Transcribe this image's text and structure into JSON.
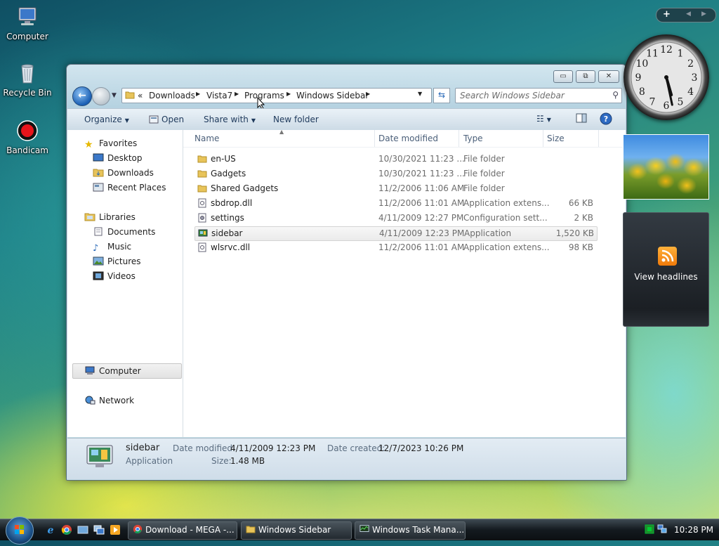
{
  "desktop": {
    "icons": [
      {
        "label": "Computer",
        "icon": "computer-icon"
      },
      {
        "label": "Recycle Bin",
        "icon": "recycle-bin-icon"
      },
      {
        "label": "Bandicam",
        "icon": "bandicam-icon"
      }
    ]
  },
  "window": {
    "buttons": {
      "minimize": "▭",
      "maximize": "⧉",
      "close": "✕"
    },
    "breadcrumb": [
      "«",
      "Downloads",
      "Vista7",
      "Programs",
      "Windows Sidebar"
    ],
    "search_placeholder": "Search Windows Sidebar",
    "toolbar": {
      "organize": "Organize",
      "open": "Open",
      "share_with": "Share with",
      "new_folder": "New folder"
    },
    "nav": {
      "favorites": "Favorites",
      "desktop": "Desktop",
      "downloads": "Downloads",
      "recent_places": "Recent Places",
      "libraries": "Libraries",
      "documents": "Documents",
      "music": "Music",
      "pictures": "Pictures",
      "videos": "Videos",
      "computer": "Computer",
      "network": "Network"
    },
    "columns": {
      "name": "Name",
      "date_modified": "Date modified",
      "type": "Type",
      "size": "Size"
    },
    "files": [
      {
        "name": "en-US",
        "date": "10/30/2021 11:23 ...",
        "type": "File folder",
        "size": "",
        "icon": "folder-icon"
      },
      {
        "name": "Gadgets",
        "date": "10/30/2021 11:23 ...",
        "type": "File folder",
        "size": "",
        "icon": "folder-icon"
      },
      {
        "name": "Shared Gadgets",
        "date": "11/2/2006 11:06 AM",
        "type": "File folder",
        "size": "",
        "icon": "folder-icon"
      },
      {
        "name": "sbdrop.dll",
        "date": "11/2/2006 11:01 AM",
        "type": "Application extens...",
        "size": "66 KB",
        "icon": "dll-file-icon"
      },
      {
        "name": "settings",
        "date": "4/11/2009 12:27 PM",
        "type": "Configuration sett...",
        "size": "2 KB",
        "icon": "settings-file-icon"
      },
      {
        "name": "sidebar",
        "date": "4/11/2009 12:23 PM",
        "type": "Application",
        "size": "1,520 KB",
        "icon": "application-icon"
      },
      {
        "name": "wlsrvc.dll",
        "date": "11/2/2006 11:01 AM",
        "type": "Application extens...",
        "size": "98 KB",
        "icon": "dll-file-icon"
      }
    ],
    "details": {
      "name": "sidebar",
      "type": "Application",
      "date_modified_label": "Date modified:",
      "date_modified": "4/11/2009 12:23 PM",
      "date_created_label": "Date created:",
      "date_created": "12/7/2023 10:26 PM",
      "size_label": "Size:",
      "size": "1.48 MB"
    }
  },
  "gadgets": {
    "sidebar_controls": [
      "+",
      "◀",
      "▶"
    ],
    "clock_numbers": [
      "12",
      "1",
      "2",
      "3",
      "4",
      "5",
      "6",
      "7",
      "8",
      "9",
      "10",
      "11"
    ],
    "clock_time": {
      "hour": 5,
      "minute": 28
    },
    "feed_label": "View headlines"
  },
  "taskbar": {
    "tasks": [
      {
        "label": "Download - MEGA -...",
        "icon": "chrome-icon"
      },
      {
        "label": "Windows Sidebar",
        "icon": "folder-icon"
      },
      {
        "label": "Windows Task Mana...",
        "icon": "task-manager-icon"
      }
    ],
    "clock": "10:28 PM"
  },
  "colors": {
    "accent": "#1a5fb4",
    "folder": "#e8c45a",
    "selection": "#ebebeb"
  }
}
